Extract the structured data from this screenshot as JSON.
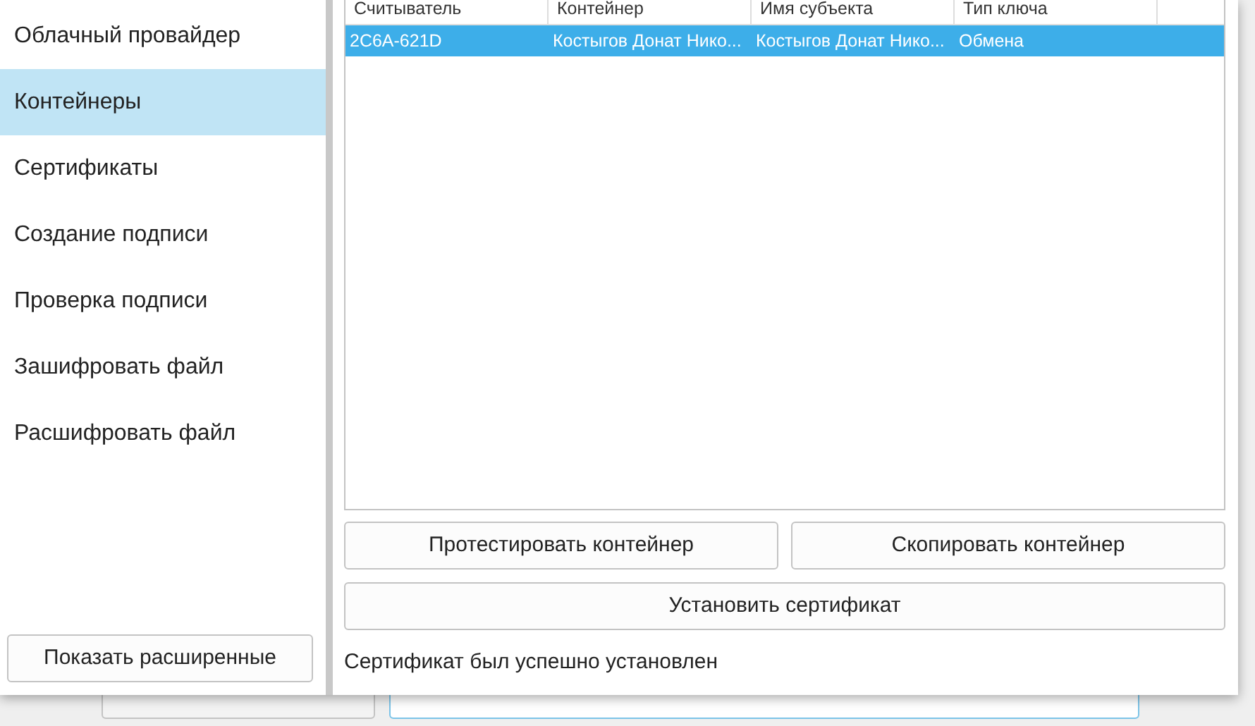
{
  "sidebar": {
    "items": [
      {
        "label": "Облачный провайдер",
        "selected": false
      },
      {
        "label": "Контейнеры",
        "selected": true
      },
      {
        "label": "Сертификаты",
        "selected": false
      },
      {
        "label": "Создание подписи",
        "selected": false
      },
      {
        "label": "Проверка подписи",
        "selected": false
      },
      {
        "label": "Зашифровать файл",
        "selected": false
      },
      {
        "label": "Расшифровать файл",
        "selected": false
      }
    ],
    "button": "Показать расширенные"
  },
  "table": {
    "columns": [
      "Считыватель",
      "Контейнер",
      "Имя субъекта",
      "Тип ключа"
    ],
    "rows": [
      {
        "cells": [
          "2C6A-621D",
          "Костыгов Донат Нико...",
          "Костыгов Донат Нико...",
          "Обмена"
        ],
        "selected": true
      }
    ]
  },
  "buttons": [
    "Протестировать контейнер",
    "Скопировать контейнер"
  ],
  "install_button": "Установить сертификат",
  "status": "Сертификат был успешно установлен"
}
